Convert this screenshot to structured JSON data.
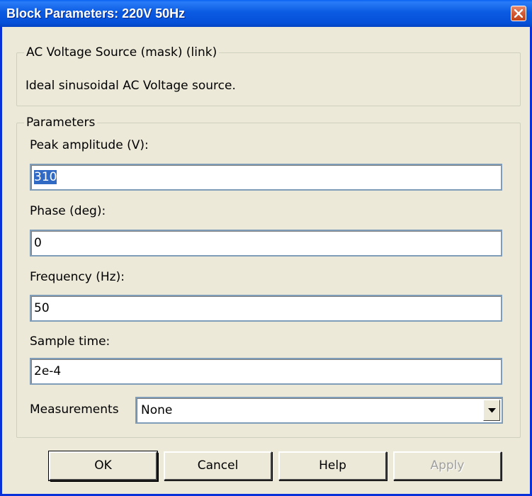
{
  "window": {
    "title": "Block Parameters: 220V 50Hz"
  },
  "mask_group": {
    "legend": "AC Voltage Source (mask) (link)",
    "description": "Ideal sinusoidal AC Voltage source."
  },
  "params_group": {
    "legend": "Parameters",
    "fields": [
      {
        "label": "Peak amplitude (V):",
        "value": "310"
      },
      {
        "label": "Phase (deg):",
        "value": "0"
      },
      {
        "label": "Frequency (Hz):",
        "value": "50"
      },
      {
        "label": "Sample time:",
        "value": "2e-4"
      }
    ],
    "measurements": {
      "label": "Measurements",
      "selected": "None"
    }
  },
  "buttons": {
    "ok": "OK",
    "cancel": "Cancel",
    "help": "Help",
    "apply": "Apply"
  },
  "colors": {
    "titlebar": "#0550d8",
    "face": "#ece9d8",
    "selection": "#316ac5",
    "field_border": "#7f9db9"
  },
  "icons": {
    "close": "close-icon",
    "dropdown": "chevron-down-icon"
  }
}
